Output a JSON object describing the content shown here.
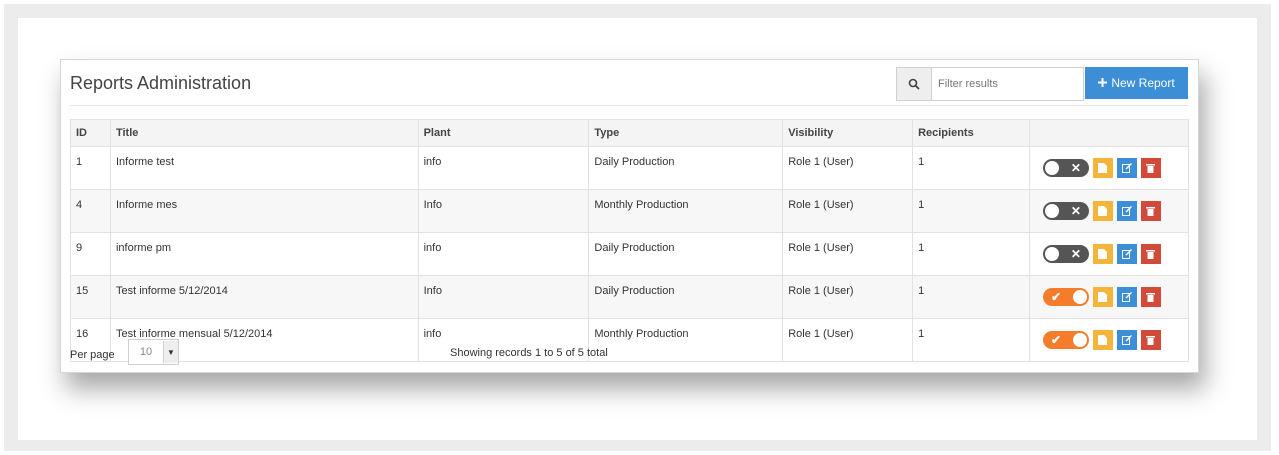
{
  "header": {
    "title": "Reports Administration",
    "search_placeholder": "Filter results",
    "new_report_label": "New Report"
  },
  "table": {
    "columns": [
      "ID",
      "Title",
      "Plant",
      "Type",
      "Visibility",
      "Recipients",
      ""
    ],
    "rows": [
      {
        "id": "1",
        "title": "Informe test",
        "plant": "info",
        "type": "Daily Production",
        "visibility": "Role 1 (User)",
        "recipients": "1",
        "active": false
      },
      {
        "id": "4",
        "title": "Informe mes",
        "plant": "Info",
        "type": "Monthly Production",
        "visibility": "Role 1 (User)",
        "recipients": "1",
        "active": false
      },
      {
        "id": "9",
        "title": "informe pm",
        "plant": "info",
        "type": "Daily Production",
        "visibility": "Role 1 (User)",
        "recipients": "1",
        "active": false
      },
      {
        "id": "15",
        "title": "Test informe 5/12/2014",
        "plant": "Info",
        "type": "Daily Production",
        "visibility": "Role 1 (User)",
        "recipients": "1",
        "active": true
      },
      {
        "id": "16",
        "title": "Test informe mensual 5/12/2014",
        "plant": "info",
        "type": "Monthly Production",
        "visibility": "Role 1 (User)",
        "recipients": "1",
        "active": true
      }
    ]
  },
  "footer": {
    "per_page_label": "Per page",
    "per_page_value": "10",
    "showing_text": "Showing records 1 to 5 of 5 total"
  },
  "icons": {
    "search": "search-icon",
    "plus": "plus-icon",
    "toggle_off": "x-icon",
    "toggle_on": "check-icon",
    "row_actions": [
      "document-icon",
      "edit-icon",
      "delete-icon"
    ]
  },
  "colors": {
    "primary": "#3c8fd6",
    "toggle_on": "#f57c2b",
    "toggle_off": "#555555",
    "action_document": "#f5b53a",
    "action_edit": "#3c8fd6",
    "action_delete": "#d24a3a"
  }
}
